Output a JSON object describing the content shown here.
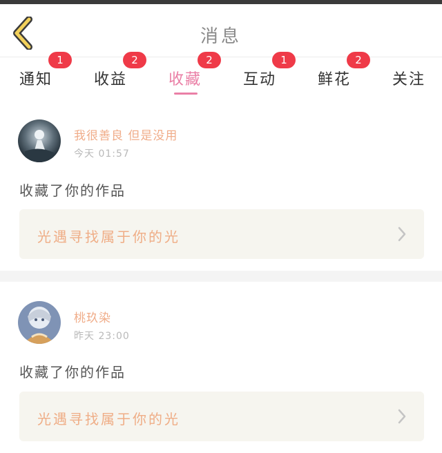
{
  "header": {
    "title": "消息",
    "back_icon": "chevron-left-icon",
    "accent": "#f2d05a"
  },
  "tabs": [
    {
      "label": "通知",
      "badge": "1",
      "active": false
    },
    {
      "label": "收益",
      "badge": "2",
      "active": false
    },
    {
      "label": "收藏",
      "badge": "2",
      "active": true
    },
    {
      "label": "互动",
      "badge": "1",
      "active": false
    },
    {
      "label": "鲜花",
      "badge": "2",
      "active": false
    },
    {
      "label": "关注",
      "badge": "",
      "active": false
    }
  ],
  "messages": [
    {
      "username": "我很善良 但是没用",
      "time": "今天 01:57",
      "action": "收藏了你的作品",
      "work_title": "光遇寻找属于你的光"
    },
    {
      "username": "桃玖染",
      "time": "昨天 23:00",
      "action": "收藏了你的作品",
      "work_title": "光遇寻找属于你的光"
    }
  ],
  "colors": {
    "active_tab": "#ea7fa6",
    "badge": "#ef3a48",
    "username": "#f0ad8a",
    "work_title": "#efad86"
  }
}
